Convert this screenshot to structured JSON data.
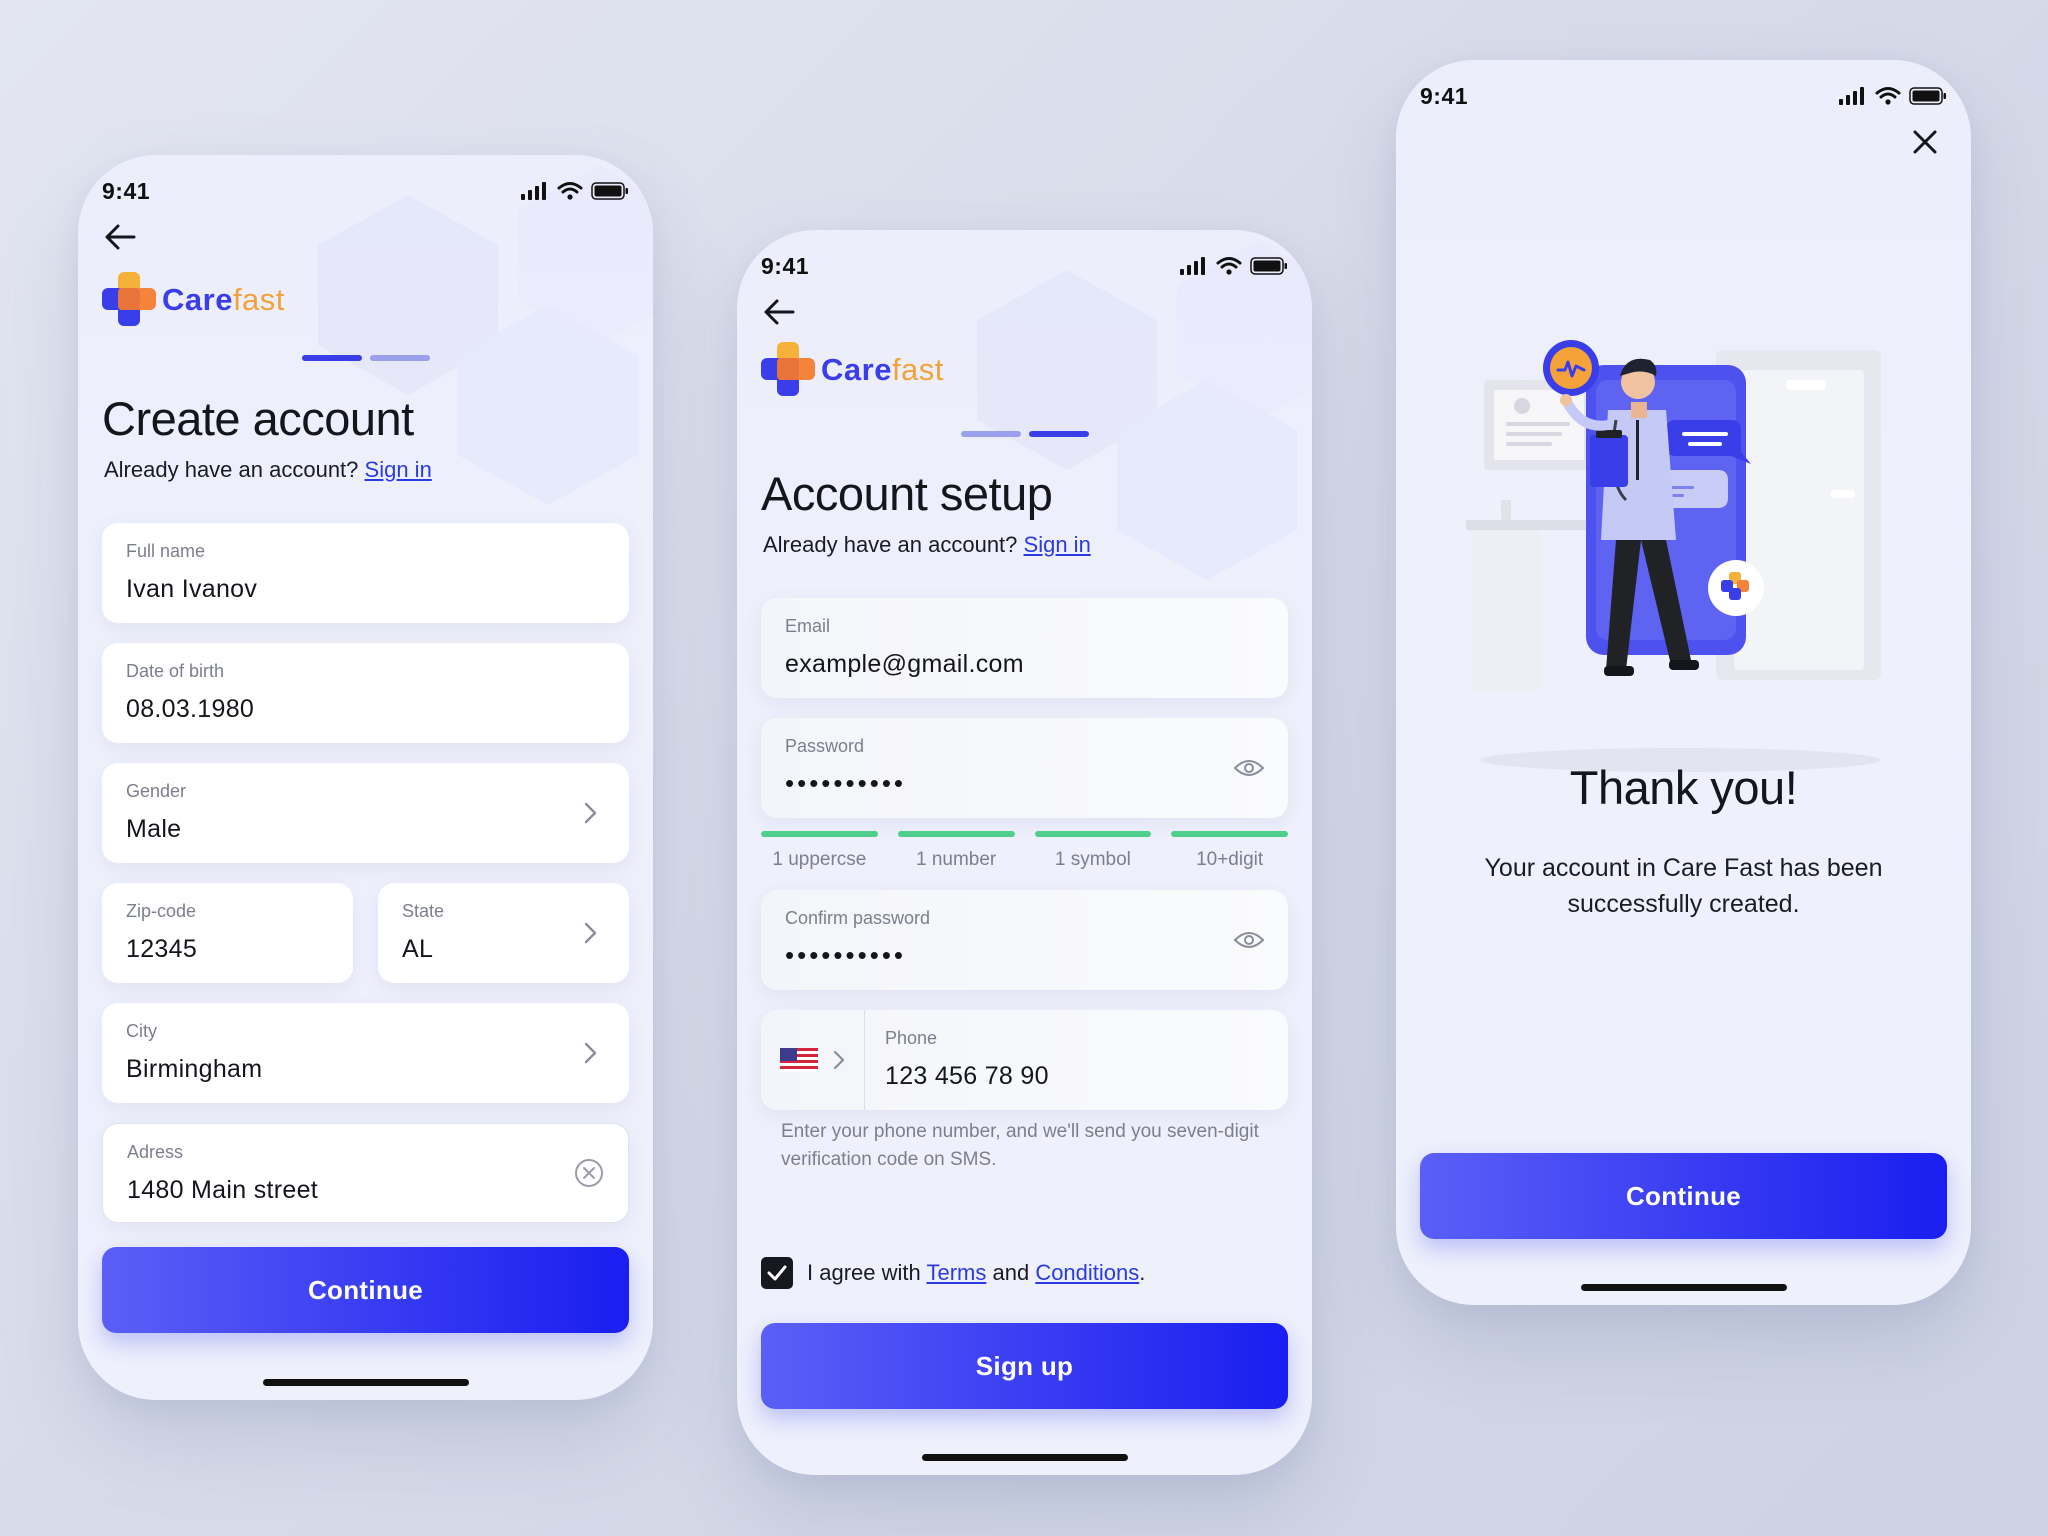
{
  "brand": {
    "care": "Care",
    "fast": "fast",
    "accent": "#3a3ee8",
    "orange": "#f2a23a"
  },
  "status": {
    "time": "9:41"
  },
  "screen1": {
    "title": "Create account",
    "have_account": "Already have an account?",
    "sign_in": "Sign in",
    "fields": {
      "full_name": {
        "label": "Full name",
        "value": "Ivan Ivanov"
      },
      "dob": {
        "label": "Date of birth",
        "value": "08.03.1980"
      },
      "gender": {
        "label": "Gender",
        "value": "Male"
      },
      "zip": {
        "label": "Zip-code",
        "value": "12345"
      },
      "state": {
        "label": "State",
        "value": "AL"
      },
      "city": {
        "label": "City",
        "value": "Birmingham"
      },
      "address": {
        "label": "Adress",
        "value": "1480 Main street"
      }
    },
    "continue": "Continue"
  },
  "screen2": {
    "title": "Account setup",
    "have_account": "Already have an account?",
    "sign_in": "Sign in",
    "email": {
      "label": "Email",
      "value": "example@gmail.com"
    },
    "password": {
      "label": "Password",
      "value": "••••••••••"
    },
    "rules": [
      "1 uppercse",
      "1 number",
      "1 symbol",
      "10+digit"
    ],
    "confirm": {
      "label": "Confirm password",
      "value": "••••••••••"
    },
    "phone": {
      "label": "Phone",
      "value": "123 456 78 90"
    },
    "helper": "Enter your phone number, and we'll send you seven-digit verification code on SMS.",
    "agree_prefix": "I agree with",
    "terms": "Terms",
    "and": "and",
    "conditions": "Conditions",
    "period": ".",
    "sign_up": "Sign up"
  },
  "screen3": {
    "title": "Thank you!",
    "message": "Your account in Care Fast has been successfully created.",
    "continue": "Continue"
  }
}
